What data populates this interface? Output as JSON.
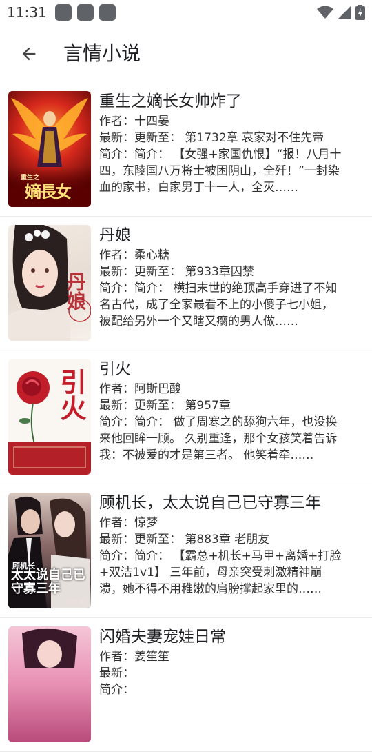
{
  "status_bar": {
    "time": "11:31"
  },
  "header": {
    "title": "言情小说"
  },
  "books": [
    {
      "title": "重生之嫡长女帅炸了",
      "author_label": "作者：",
      "author": "十四晏",
      "latest_label": "最新：",
      "latest": "更新至： 第1732章 哀家对不住先帝",
      "intro_label": "简介：",
      "intro": "简介： 【女强+家国仇恨】“报！八月十四，东陵国八万将士被困阴山，全歼！”一封染血的家书，白家男丁十一人，全灭……",
      "cover_text": "嫡長女",
      "cover_sub": "重生之"
    },
    {
      "title": "丹娘",
      "author_label": "作者：",
      "author": "柔心糖",
      "latest_label": "最新：",
      "latest": "更新至： 第933章囚禁",
      "intro_label": "简介：",
      "intro": "简介： 横扫末世的绝顶高手穿进了不知名古代，成了全家最看不上的小傻子七小姐，被配给另外一个又瞎又瘸的男人做……",
      "cover_text": "丹娘"
    },
    {
      "title": "引火",
      "author_label": "作者：",
      "author": "阿斯巴酸",
      "latest_label": "最新：",
      "latest": "更新至： 第957章",
      "intro_label": "简介：",
      "intro": "简介： 做了周寒之的舔狗六年，也没换来他回眸一顾。 久别重逢，那个女孩笑着告诉我：不被爱的才是第三者。 他笑着牵……",
      "cover_text": "引火"
    },
    {
      "title": "顾机长，太太说自己已守寡三年",
      "author_label": "作者：",
      "author": "惊梦",
      "latest_label": "最新：",
      "latest": "更新至： 第883章 老朋友",
      "intro_label": "简介：",
      "intro": "简介： 【霸总+机长+马甲+离婚+打脸+双洁1v1】 三年前，母亲突受刺激精神崩溃，她不得不用稚嫩的肩膀撑起家里的……",
      "cover_text": "太太说自己已守寡三年",
      "cover_sub": "顾机长",
      "cover_author": "惊梦 著"
    },
    {
      "title": "闪婚夫妻宠娃日常",
      "author_label": "作者：",
      "author": "姜笙笙",
      "latest_label": "最新：",
      "latest": "",
      "intro_label": "简介：",
      "intro": "",
      "cover_text": ""
    }
  ],
  "colors": {
    "background": "#ffffff",
    "text": "#333333",
    "divider": "#ececec"
  }
}
